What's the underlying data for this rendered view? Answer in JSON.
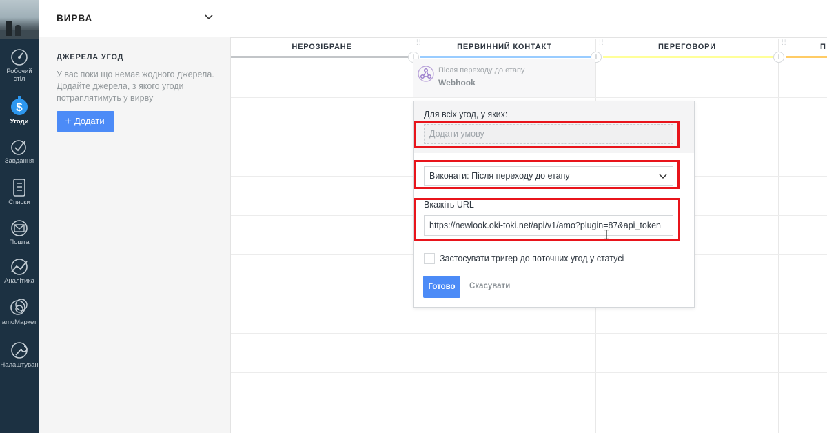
{
  "nav": {
    "items": [
      {
        "label": "Робочий\nстіл",
        "icon": "dashboard-icon"
      },
      {
        "label": "Угоди",
        "icon": "dollar-icon",
        "active": true
      },
      {
        "label": "Завдання",
        "icon": "check-circle-icon"
      },
      {
        "label": "Списки",
        "icon": "list-doc-icon"
      },
      {
        "label": "Пошта",
        "icon": "mail-icon"
      },
      {
        "label": "Аналітика",
        "icon": "analytics-icon"
      },
      {
        "label": "amoМаркет",
        "icon": "market-icon"
      },
      {
        "label": "Налаштуван",
        "icon": "wrench-icon"
      }
    ],
    "active_color": "#2d97ef"
  },
  "panel": {
    "title": "ВИРВА",
    "sources_title": "ДЖЕРЕЛА УГОД",
    "sources_empty": "У вас поки що немає жодного джерела. Додайте джерела, з якого угоди потраплятимуть у вирву",
    "add_button": "Додати"
  },
  "board": {
    "columns": [
      {
        "name": "НЕРОЗІБРАНЕ",
        "color": "#c2c5c8"
      },
      {
        "name": "ПЕРВИННИЙ КОНТАКТ",
        "color": "#99ccff"
      },
      {
        "name": "ПЕРЕГОВОРИ",
        "color": "#ffff99"
      },
      {
        "name": "П",
        "color": "#ffcc66"
      }
    ],
    "trigger": {
      "when": "Після переходу до етапу",
      "name": "Webhook"
    }
  },
  "popup": {
    "for_all_label": "Для всіх угод, у яких:",
    "condition_placeholder": "Додати умову",
    "execute_label": "Виконати:  Після переходу до етапу",
    "url_label": "Вкажіть URL",
    "url_value": "https://newlook.oki-toki.net/api/v1/amo?plugin=87&api_token",
    "apply_checkbox_label": "Застосувати тригер до поточних угод у статусі",
    "apply_checked": false,
    "done_button": "Готово",
    "cancel_button": "Скасувати"
  },
  "colors": {
    "sidebar_bg": "#1c3142",
    "primary_button": "#4c8bf7",
    "highlight": "#e8141b"
  }
}
